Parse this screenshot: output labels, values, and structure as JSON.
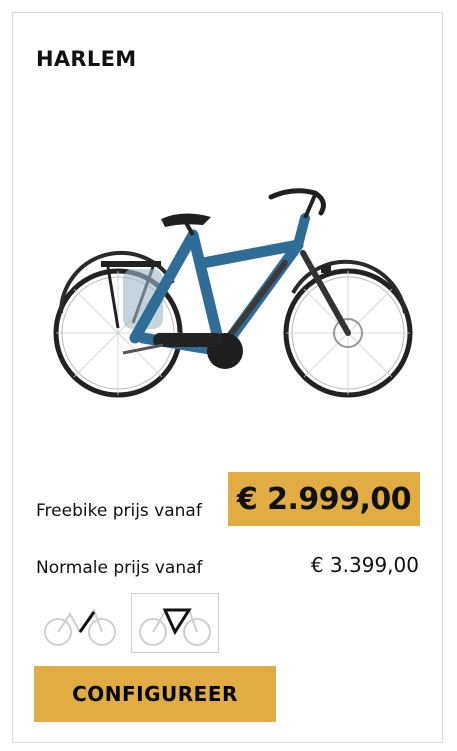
{
  "product": {
    "name": "HARLEM",
    "image_icon": "e-bike-image"
  },
  "pricing": {
    "freebike_label": "Freebike prijs vanaf",
    "freebike_price": "€ 2.999,00",
    "normal_label": "Normale prijs vanaf",
    "normal_price": "€ 3.399,00"
  },
  "frame_options": [
    {
      "icon": "low-step-frame-icon"
    },
    {
      "icon": "diamond-frame-icon",
      "selected": true
    }
  ],
  "actions": {
    "configure_label": "CONFIGUREER"
  },
  "colors": {
    "accent": "#e1ac42",
    "bike_blue": "#2f6d96",
    "border": "#dcdcdc"
  }
}
